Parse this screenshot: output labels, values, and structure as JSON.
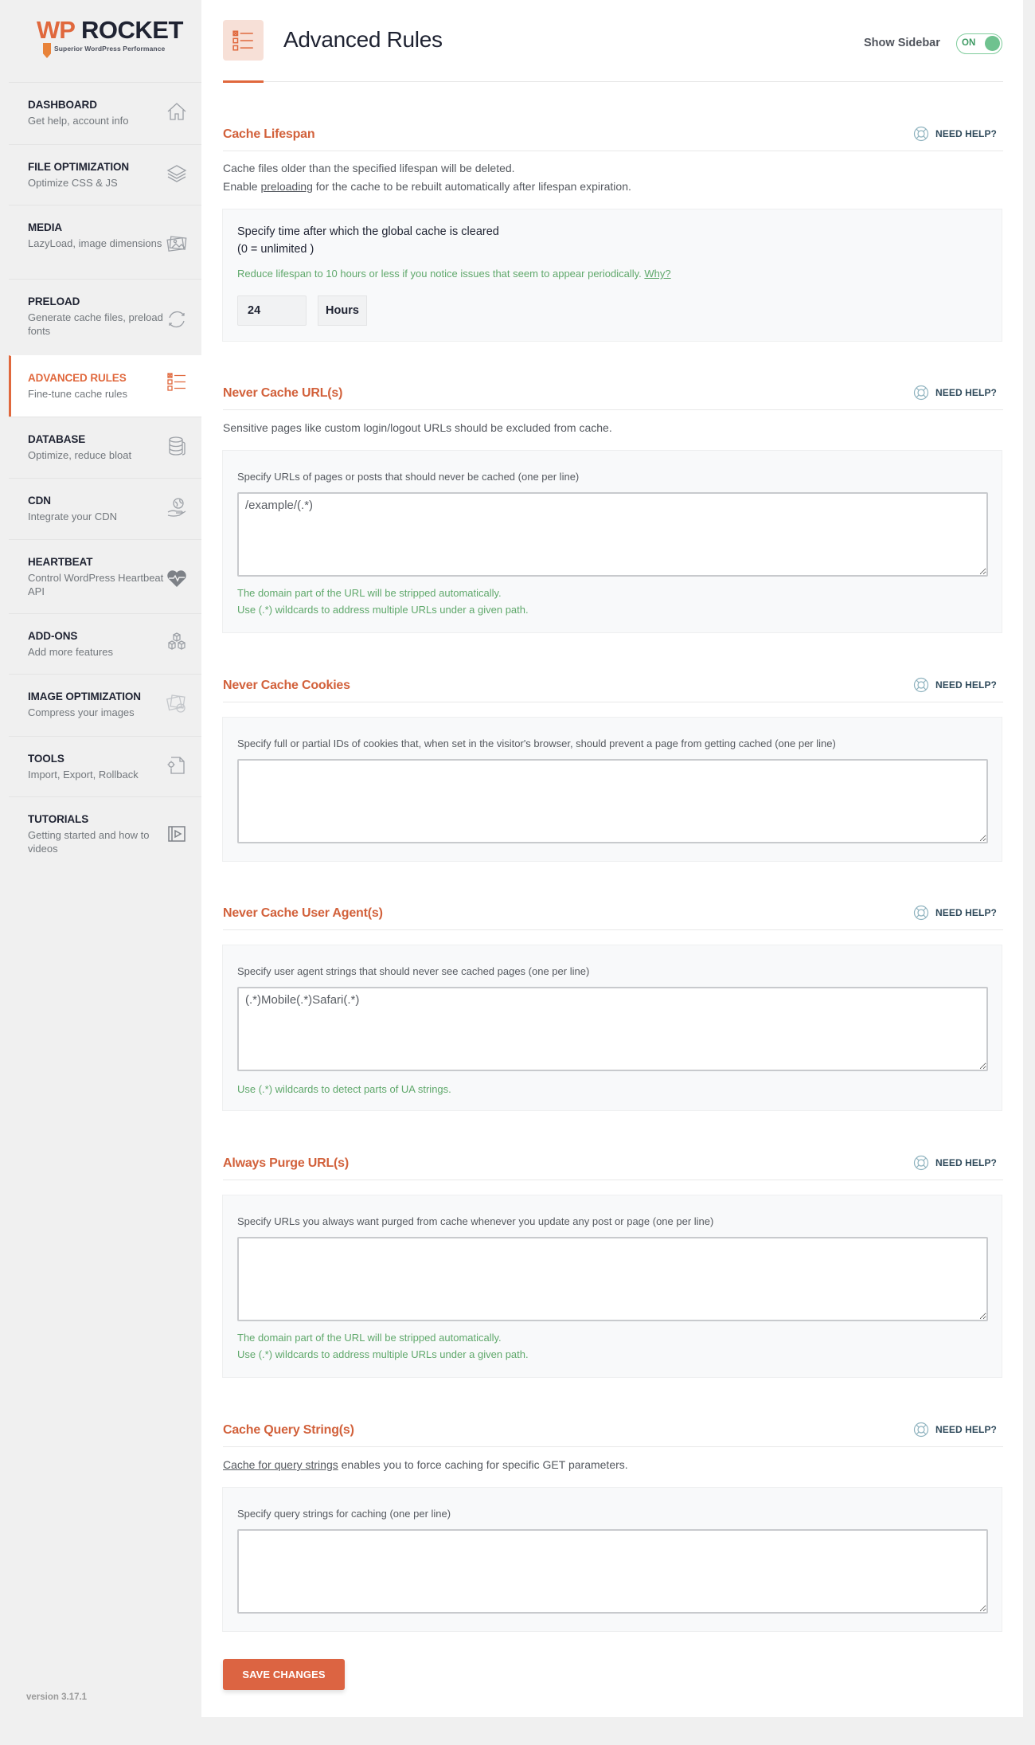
{
  "brand": {
    "logo_wp": "WP",
    "logo_rocket": "ROCKET",
    "tagline": "Superior WordPress Performance",
    "accent_color": "#e0683d"
  },
  "sidebar": {
    "items": [
      {
        "title": "DASHBOARD",
        "subtitle": "Get help, account info",
        "icon": "home-icon",
        "active": false
      },
      {
        "title": "FILE OPTIMIZATION",
        "subtitle": "Optimize CSS & JS",
        "icon": "layers-icon",
        "active": false
      },
      {
        "title": "MEDIA",
        "subtitle": "LazyLoad, image dimensions",
        "icon": "images-icon",
        "active": false
      },
      {
        "title": "PRELOAD",
        "subtitle": "Generate cache files, preload fonts",
        "icon": "refresh-icon",
        "active": false
      },
      {
        "title": "ADVANCED RULES",
        "subtitle": "Fine-tune cache rules",
        "icon": "checklist-icon",
        "active": true
      },
      {
        "title": "DATABASE",
        "subtitle": "Optimize, reduce bloat",
        "icon": "database-icon",
        "active": false
      },
      {
        "title": "CDN",
        "subtitle": "Integrate your CDN",
        "icon": "globe-hand-icon",
        "active": false
      },
      {
        "title": "HEARTBEAT",
        "subtitle": "Control WordPress Heartbeat API",
        "icon": "heartbeat-icon",
        "active": false
      },
      {
        "title": "ADD-ONS",
        "subtitle": "Add more features",
        "icon": "cubes-icon",
        "active": false
      },
      {
        "title": "IMAGE OPTIMIZATION",
        "subtitle": "Compress your images",
        "icon": "image-compress-icon",
        "active": false
      },
      {
        "title": "TOOLS",
        "subtitle": "Import, Export, Rollback",
        "icon": "file-gear-icon",
        "active": false
      },
      {
        "title": "TUTORIALS",
        "subtitle": "Getting started and how to videos",
        "icon": "video-icon",
        "active": false
      }
    ],
    "version": "version 3.17.1"
  },
  "header": {
    "title": "Advanced Rules",
    "show_sidebar_label": "Show Sidebar",
    "toggle_label": "ON",
    "toggle_state": true
  },
  "need_help_label": "NEED HELP?",
  "sections": {
    "cache_lifespan": {
      "title": "Cache Lifespan",
      "desc_line1": "Cache files older than the specified lifespan will be deleted.",
      "desc_line2_pre": "Enable ",
      "desc_line2_link": "preloading",
      "desc_line2_post": " for the cache to be rebuilt automatically after lifespan expiration.",
      "field_label_line1": "Specify time after which the global cache is cleared",
      "field_label_line2": "(0 = unlimited )",
      "hint": "Reduce lifespan to 10 hours or less if you notice issues that seem to appear periodically.",
      "hint_link": "Why?",
      "value": "24",
      "unit": "Hours"
    },
    "never_cache_urls": {
      "title": "Never Cache URL(s)",
      "desc": "Sensitive pages like custom login/logout URLs should be excluded from cache.",
      "field_label": "Specify URLs of pages or posts that should never be cached (one per line)",
      "value": "/example/(.*)",
      "hint_line1": "The domain part of the URL will be stripped automatically.",
      "hint_line2": "Use (.*) wildcards to address multiple URLs under a given path."
    },
    "never_cache_cookies": {
      "title": "Never Cache Cookies",
      "field_label": "Specify full or partial IDs of cookies that, when set in the visitor's browser, should prevent a page from getting cached (one per line)",
      "value": ""
    },
    "never_cache_user_agents": {
      "title": "Never Cache User Agent(s)",
      "field_label": "Specify user agent strings that should never see cached pages (one per line)",
      "value": "(.*)Mobile(.*)Safari(.*)",
      "hint": "Use (.*) wildcards to detect parts of UA strings."
    },
    "always_purge_urls": {
      "title": "Always Purge URL(s)",
      "field_label": "Specify URLs you always want purged from cache whenever you update any post or page (one per line)",
      "value": "",
      "hint_line1": "The domain part of the URL will be stripped automatically.",
      "hint_line2": "Use (.*) wildcards to address multiple URLs under a given path."
    },
    "cache_query_strings": {
      "title": "Cache Query String(s)",
      "desc_link": "Cache for query strings",
      "desc_post": " enables you to force caching for specific GET parameters.",
      "field_label": "Specify query strings for caching (one per line)",
      "value": ""
    }
  },
  "save_button_label": "SAVE CHANGES"
}
